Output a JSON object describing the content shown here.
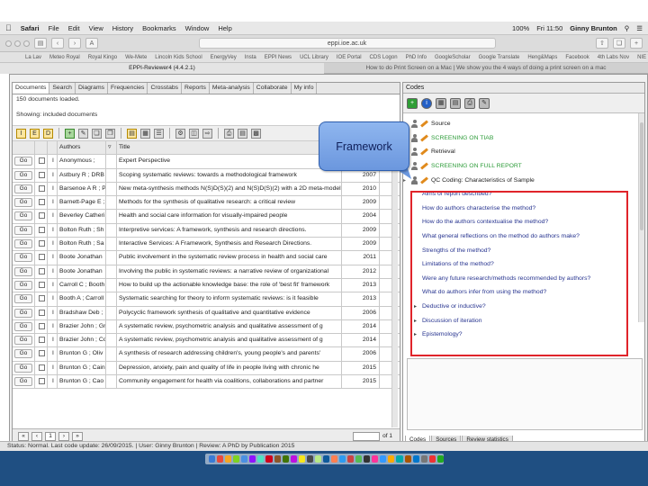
{
  "menubar": {
    "apple": "",
    "app": "Safari",
    "items": [
      "File",
      "Edit",
      "View",
      "History",
      "Bookmarks",
      "Window",
      "Help"
    ],
    "battery": "100%",
    "clock": "Fri 11:50",
    "user": "Ginny Brunton"
  },
  "browser": {
    "url": "eppi.ioe.ac.uk",
    "bookmarks": [
      "La Lav",
      "Meteo Royal",
      "Royal Kingo",
      "We-Mete",
      "Lincoln Kids School",
      "EnergyVey",
      "Insta",
      "EPPI News",
      "UCL Library",
      "IOE Portal",
      "CDS Logon",
      "PhD Info",
      "GoogleScholar",
      "Google Translate",
      "Heng&Maps",
      "Facebook",
      "4th Labs Nov",
      "NIE Vault"
    ],
    "tabs": [
      "EPPI-Reviewer4 (4.4.2.1)",
      "How to do Print Screen on a Mac | We show you the 4 ways of doing a print screen on a mac"
    ]
  },
  "left": {
    "tabs": [
      "Documents",
      "Search",
      "Diagrams",
      "Frequencies",
      "Crosstabs",
      "Reports",
      "Meta-analysis",
      "Collaborate",
      "My info"
    ],
    "loaded": "150 documents loaded.",
    "showing": "Showing: included documents",
    "headers": {
      "authors": "Authors",
      "title": "Title"
    },
    "go": "Go",
    "i": "I",
    "rows": [
      {
        "authors": "Anonymous ;",
        "title": "Expert Perspective",
        "year": "2013"
      },
      {
        "authors": "Astbury R ; DRB",
        "title": "Scoping systematic reviews: towards a methodological framework",
        "year": "2007"
      },
      {
        "authors": "Barsenoe A R ; Pe",
        "title": "New meta-synthesis methods N(S)D(S)(2) and N(S)D(S)(2) with a 2D meta-model",
        "year": "2010"
      },
      {
        "authors": "Barnett-Page E ;",
        "title": "Methods for the synthesis of qualitative research: a critical review",
        "year": "2009"
      },
      {
        "authors": "Beverley Catheri",
        "title": "Health and social care information for visually-impaired people",
        "year": "2004"
      },
      {
        "authors": "Bolton Ruth ; Sh",
        "title": "Interpretive services: A framework, synthesis and research directions.",
        "year": "2009"
      },
      {
        "authors": "Bolton Ruth ; Sa",
        "title": "Interactive Services: A Framework, Synthesis and Research Directions.",
        "year": "2009"
      },
      {
        "authors": "Boote Jonathan",
        "title": "Public involvement in the systematic review process in health and social care",
        "year": "2011"
      },
      {
        "authors": "Boote Jonathan",
        "title": "Involving the public in systematic reviews: a narrative review of organizational",
        "year": "2012"
      },
      {
        "authors": "Carroll C ; Booth",
        "title": "How to build up the actionable knowledge base: the role of 'best fit' framework",
        "year": "2013"
      },
      {
        "authors": "Booth A ; Carroll",
        "title": "Systematic searching for theory to inform systematic reviews: is it feasible",
        "year": "2013"
      },
      {
        "authors": "Bradshaw Deb ;",
        "title": "Polycyclic framework synthesis of qualitative and quantitative evidence",
        "year": "2006"
      },
      {
        "authors": "Brazier John ; Gr",
        "title": "A systematic review, psychometric analysis and qualitative assessment of g",
        "year": "2014"
      },
      {
        "authors": "Brazier John ; Co",
        "title": "A systematic review, psychometric analysis and qualitative assessment of g",
        "year": "2014"
      },
      {
        "authors": "Brunton G ; Oliv",
        "title": "A synthesis of research addressing children's, young people's and parents'",
        "year": "2006"
      },
      {
        "authors": "Brunton G ; Cain",
        "title": "Depression, anxiety, pain and quality of life in people living with chronic he",
        "year": "2015"
      },
      {
        "authors": "Brunton G ; Cao",
        "title": "Community engagement for health via coalitions, collaborations and partner",
        "year": "2015"
      }
    ],
    "pager": {
      "current": "1",
      "of": "of 1"
    }
  },
  "right": {
    "title": "Codes",
    "tree": [
      {
        "label": "Source",
        "kind": "top"
      },
      {
        "label": "SCREENING ON TIAB",
        "kind": "top-green"
      },
      {
        "label": "Retrieval",
        "kind": "top"
      },
      {
        "label": "SCREENING ON FULL REPORT",
        "kind": "top-green"
      },
      {
        "label": "QC Coding: Characteristics of Sample",
        "kind": "top"
      }
    ],
    "questions": [
      "Aims of report described?",
      "How do authors characterise the method?",
      "How do the authors contextualise the method?",
      "What general reflections on the method do authors make?",
      "Strengths of the method?",
      "Limitations of the method?",
      "Were any future research/methods recommended by authors?",
      "What do authors infer from using the method?",
      "Deductive or inductive?",
      "Discussion of iteration",
      "Epistemology?"
    ],
    "bottom_tabs": [
      "Codes",
      "Sources",
      "Review statistics"
    ]
  },
  "overlay": {
    "callout": "Framework"
  },
  "status": "Status: Normal. Last code update: 26/09/2015. | User: Ginny Brunton | Review: A PhD by Publication 2015",
  "colors": {
    "highlight": "#e0242a",
    "callout": "#7aa4e6",
    "dock_bg": "#1f4f82"
  }
}
